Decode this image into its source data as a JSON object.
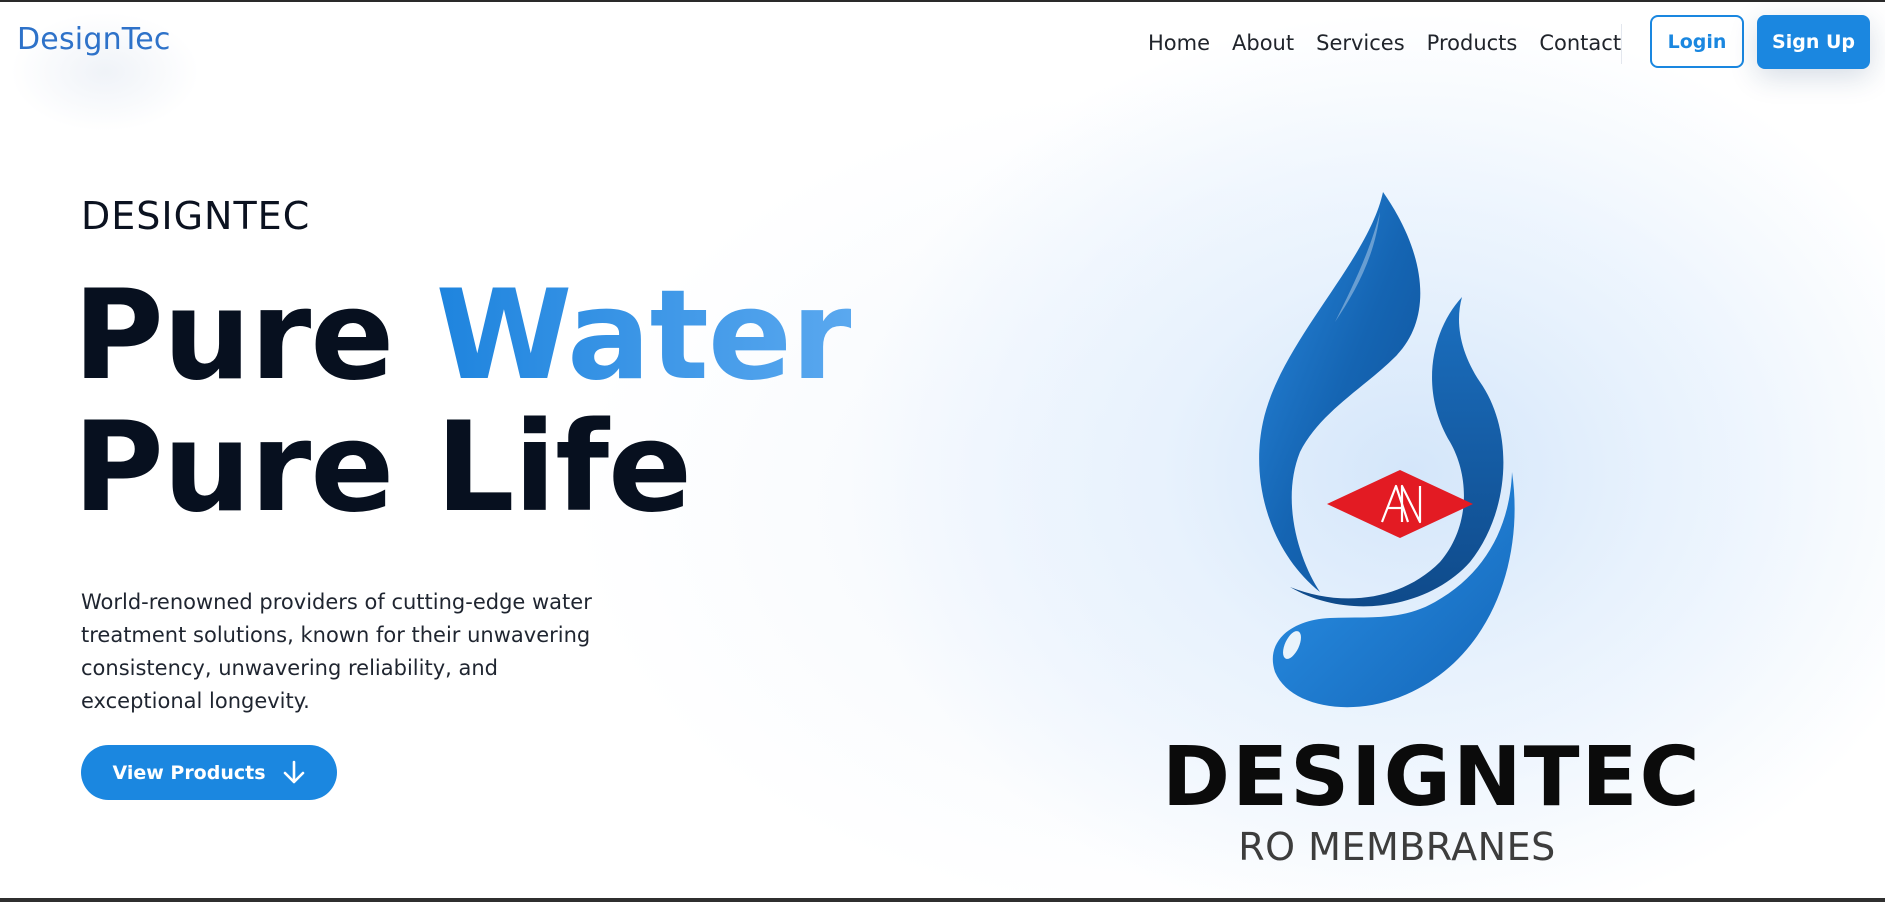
{
  "nav": {
    "brand": "DesignTec",
    "links": [
      "Home",
      "About",
      "Services",
      "Products",
      "Contact"
    ],
    "login_label": "Login",
    "signup_label": "Sign Up"
  },
  "hero": {
    "eyebrow": "DESIGNTEC",
    "headline_part1": "Pure ",
    "headline_accent": "Water",
    "headline_line2": "Pure Life",
    "description": "World-renowned providers of cutting-edge water treatment solutions, known for their unwavering consistency, unwavering reliability, and exceptional longevity.",
    "cta_label": "View Products",
    "cta_icon": "arrow-down-icon"
  },
  "logo": {
    "icon": "water-drop-logo-icon",
    "wordmark": "DESIGNTEC",
    "subtitle": "RO MEMBRANES"
  },
  "colors": {
    "primary": "#1b87e0",
    "brand_text": "#2e72c9",
    "accent_red": "#e31b23",
    "headline_dark": "#07101f"
  }
}
